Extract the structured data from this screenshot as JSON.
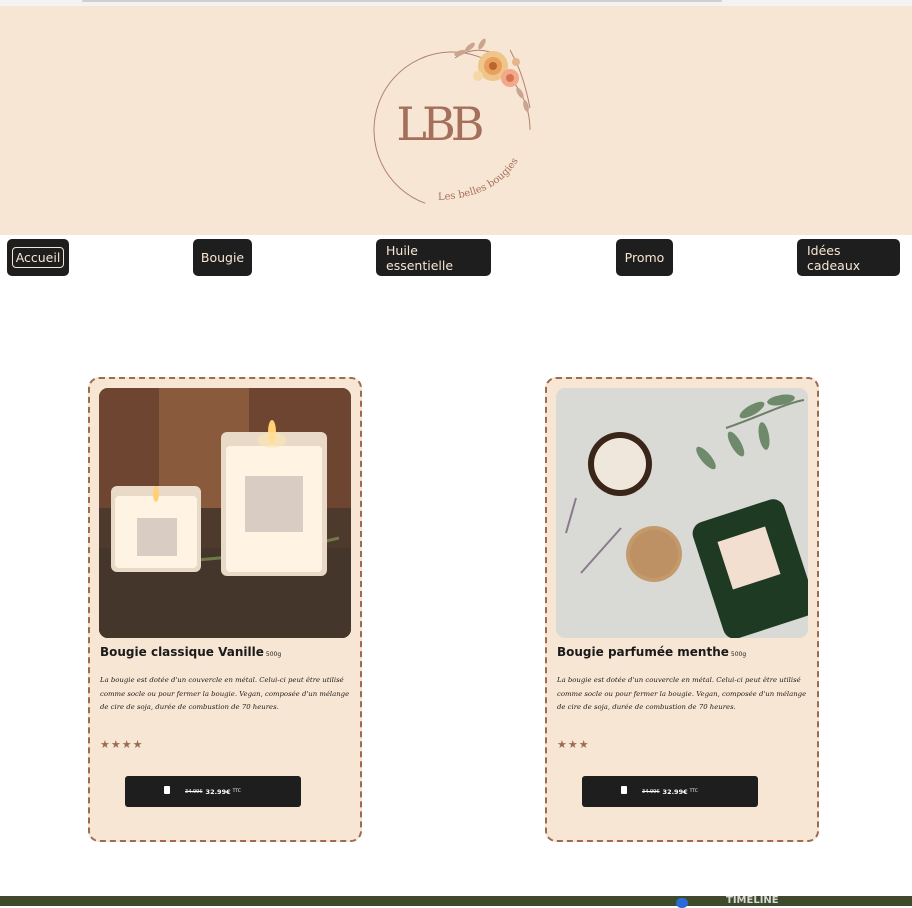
{
  "logo": {
    "monogram": "LBB",
    "tagline": "Les belles bougies"
  },
  "nav": {
    "items": [
      {
        "label": "Accueil",
        "active": true
      },
      {
        "label": "Bougie"
      },
      {
        "label": "Huile essentielle"
      },
      {
        "label": "Promo"
      },
      {
        "label": "Idées cadeaux"
      }
    ]
  },
  "products": [
    {
      "title": "Bougie classique Vanille",
      "weight": "500g",
      "description": "La bougie est dotée d'un couvercle en métal. Celui-ci peut être utilisé comme socle ou pour fermer la bougie. Vegan, composée d'un mélange de cire de soja, durée de combustion de 70 heures.",
      "rating": 4,
      "stars": "★★★★",
      "price_old": "34.99€",
      "price": "32.99€",
      "price_tax": "TTC",
      "cart_icon": "cart-icon"
    },
    {
      "title": "Bougie parfumée menthe",
      "weight": "500g",
      "description": "La bougie est dotée d'un couvercle en métal. Celui-ci peut être utilisé comme socle ou pour fermer la bougie. Vegan, composée d'un mélange de cire de soja, durée de combustion de 70 heures.",
      "rating": 3,
      "stars": "★★★",
      "price_old": "34.99€",
      "price": "32.99€",
      "price_tax": "TTC",
      "cart_icon": "cart-icon"
    }
  ],
  "footer": {
    "timeline": "TIMELINE"
  },
  "colors": {
    "header_bg": "#f8e6d4",
    "nav_bg": "#1e1e1e",
    "accent": "#9c6b52"
  }
}
